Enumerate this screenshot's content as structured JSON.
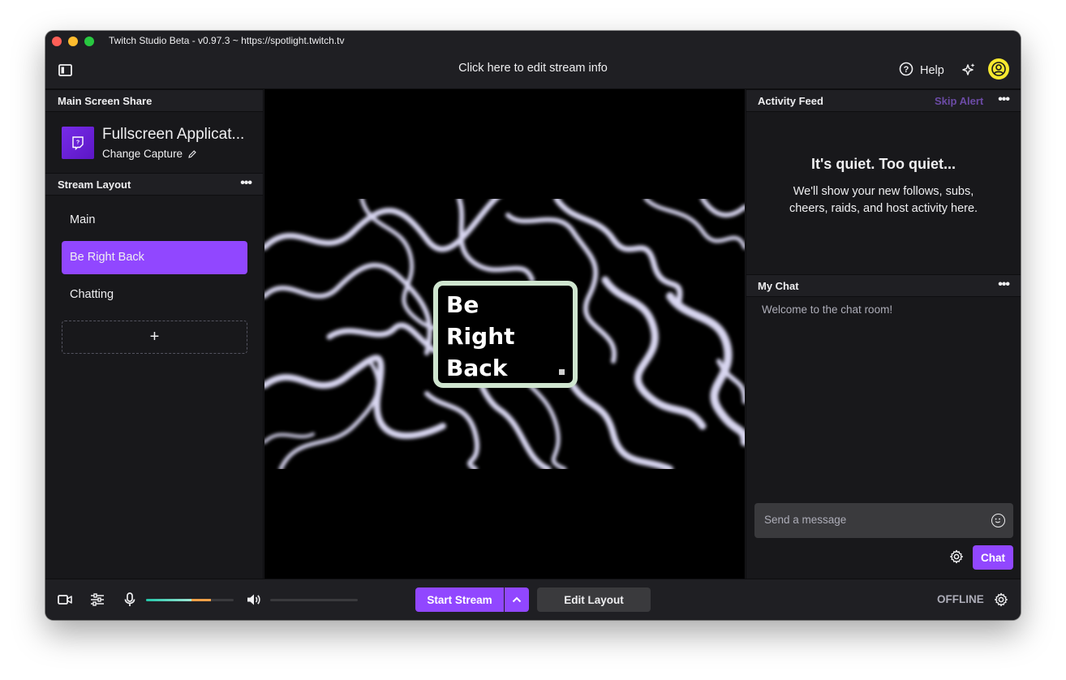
{
  "window": {
    "title": "Twitch Studio Beta - v0.97.3 ~ https://spotlight.twitch.tv"
  },
  "topbar": {
    "stream_info": "Click here to edit stream info",
    "help_label": "Help"
  },
  "left": {
    "screen_share_header": "Main Screen Share",
    "capture_title": "Fullscreen Applicat...",
    "change_capture": "Change Capture",
    "stream_layout_header": "Stream Layout",
    "layouts": [
      {
        "label": "Main",
        "active": false
      },
      {
        "label": "Be Right Back",
        "active": true
      },
      {
        "label": "Chatting",
        "active": false
      }
    ],
    "add_label": "+"
  },
  "preview": {
    "brb_lines": [
      "Be",
      "Right",
      "Back"
    ]
  },
  "right": {
    "activity_header": "Activity Feed",
    "skip_alert": "Skip Alert",
    "quiet_title": "It's quiet. Too quiet...",
    "quiet_body": "We'll show your new follows, subs, cheers, raids, and host activity here.",
    "chat_header": "My Chat",
    "welcome": "Welcome to the chat room!",
    "chat_placeholder": "Send a message",
    "chat_button": "Chat"
  },
  "bottom": {
    "start_stream": "Start Stream",
    "edit_layout": "Edit Layout",
    "status": "OFFLINE",
    "mic_level": 0.74,
    "volume_level": 0.0
  },
  "colors": {
    "accent": "#9147ff",
    "avatar": "#f6e92f",
    "skip_alert": "#6c4ba6",
    "brb_border": "#cfe5cf"
  },
  "icons": [
    "sidebar-toggle-icon",
    "help-icon",
    "sparkle-icon",
    "user-icon",
    "twitch-glitch-icon",
    "pencil-icon",
    "more-dots-icon",
    "camera-icon",
    "mixer-icon",
    "microphone-icon",
    "speaker-icon",
    "chevron-up-icon",
    "gear-icon",
    "emoji-icon"
  ]
}
